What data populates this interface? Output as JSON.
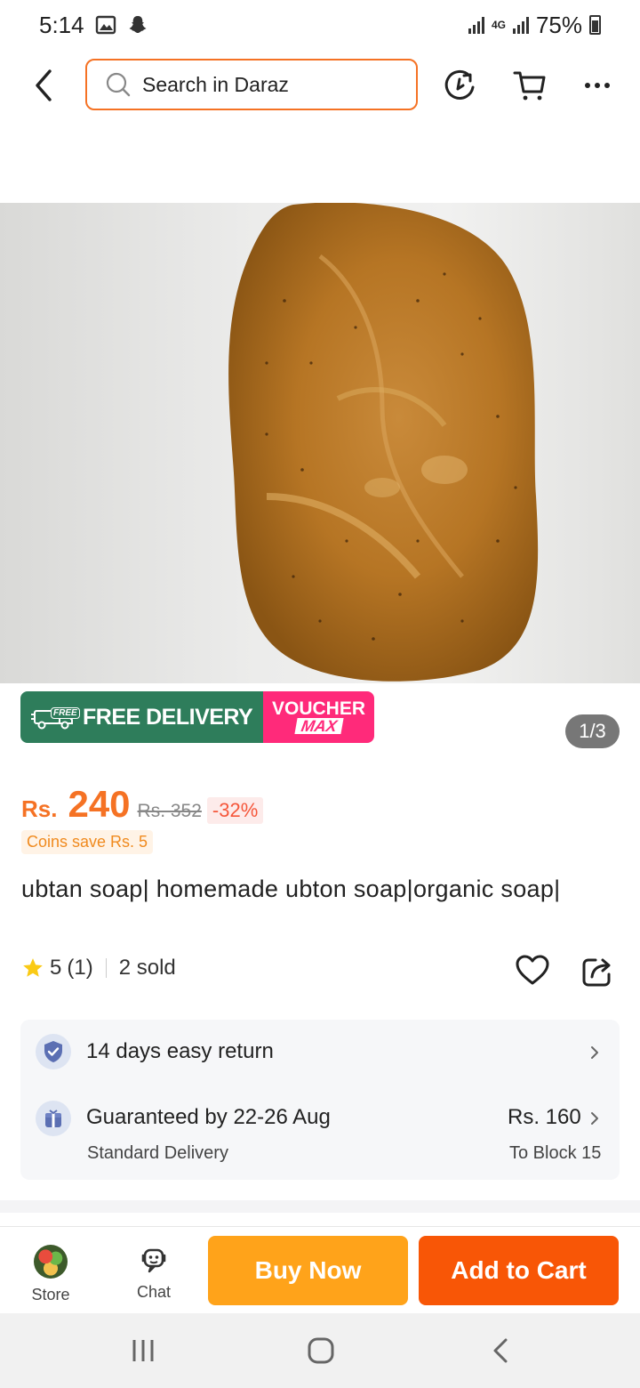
{
  "status_bar": {
    "time": "5:14",
    "network": "4G",
    "battery": "75%"
  },
  "header": {
    "search_placeholder": "Search in Daraz"
  },
  "gallery": {
    "counter": "1/3"
  },
  "promo": {
    "free_tag": "FREE",
    "free_delivery": "FREE DELIVERY",
    "voucher_line1": "VOUCHER",
    "voucher_line2": "MAX"
  },
  "price": {
    "currency": "Rs.",
    "current": "240",
    "original": "Rs. 352",
    "discount": "-32%",
    "coins": "Coins save Rs. 5"
  },
  "product": {
    "title": "ubtan soap| homemade ubton soap|organic soap|",
    "rating": "5",
    "rating_count": "(1)",
    "sold": "2 sold"
  },
  "service": {
    "returns": "14 days easy return",
    "delivery_title": "Guaranteed by 22-26 Aug",
    "delivery_type": "Standard Delivery",
    "delivery_fee": "Rs. 160",
    "delivery_location": "To Block 15"
  },
  "action_bar": {
    "store_label": "Store",
    "chat_label": "Chat",
    "buy_now": "Buy Now",
    "add_to_cart": "Add to Cart"
  },
  "colors": {
    "brand_orange": "#f57224",
    "add_to_cart": "#f85606",
    "buy_now": "#ffa31a",
    "free_delivery_green": "#2e7d5b",
    "voucher_pink": "#ff2a7a"
  }
}
